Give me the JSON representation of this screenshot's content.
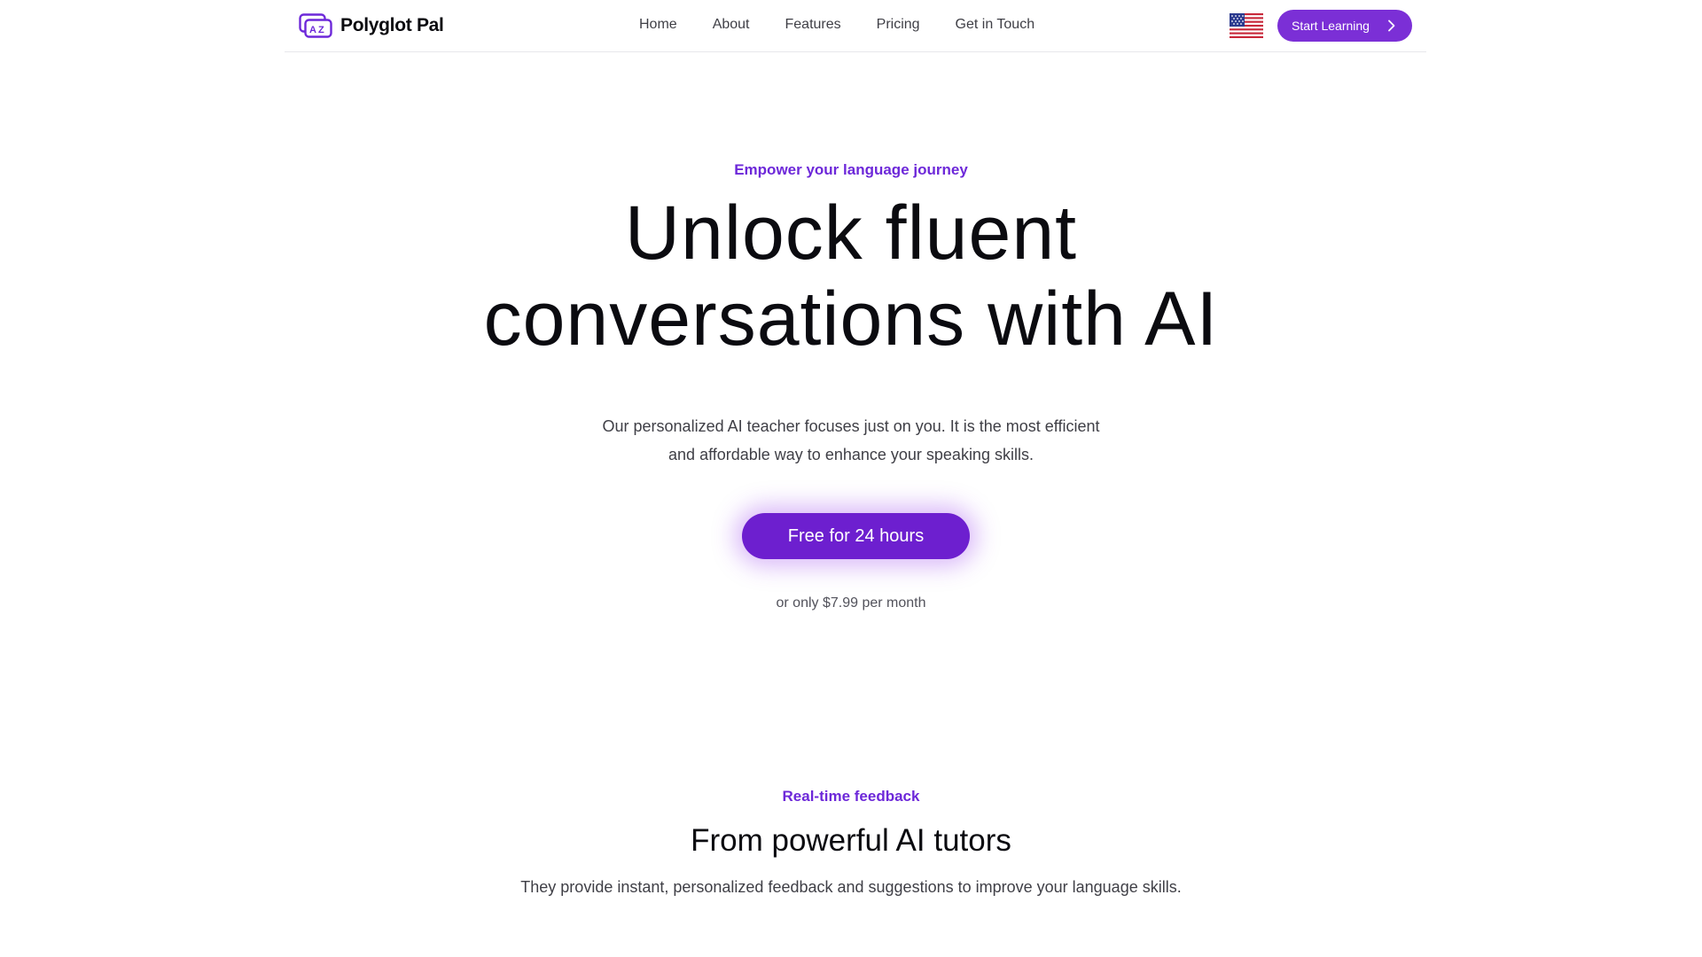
{
  "nav": {
    "logo_text": "Polyglot Pal",
    "logo_icon": "az-translate-icon",
    "links": [
      "Home",
      "About",
      "Features",
      "Pricing",
      "Get in Touch"
    ],
    "language_flag": "us-flag-icon",
    "cta_label": "Start Learning",
    "cta_icon": "chevron-right-icon"
  },
  "hero": {
    "eyebrow": "Empower your language journey",
    "title_line1": "Unlock fluent",
    "title_line2": "conversations with AI",
    "subtitle_line1": "Our personalized AI teacher focuses just on you. It is the most efficient",
    "subtitle_line2": "and affordable way to enhance your speaking skills.",
    "cta_label": "Free for 24 hours",
    "price_note": "or only $7.99 per month"
  },
  "features": {
    "eyebrow": "Real-time feedback",
    "title": "From powerful AI tutors",
    "subtitle": "They provide instant, personalized feedback and suggestions to improve your language skills."
  },
  "colors": {
    "accent": "#6d28d9",
    "button": "#7b2fd6",
    "cta": "#6d1fcf",
    "text": "#0b0b10",
    "muted_text": "#3f3f46",
    "divider": "#e7e7ec"
  }
}
